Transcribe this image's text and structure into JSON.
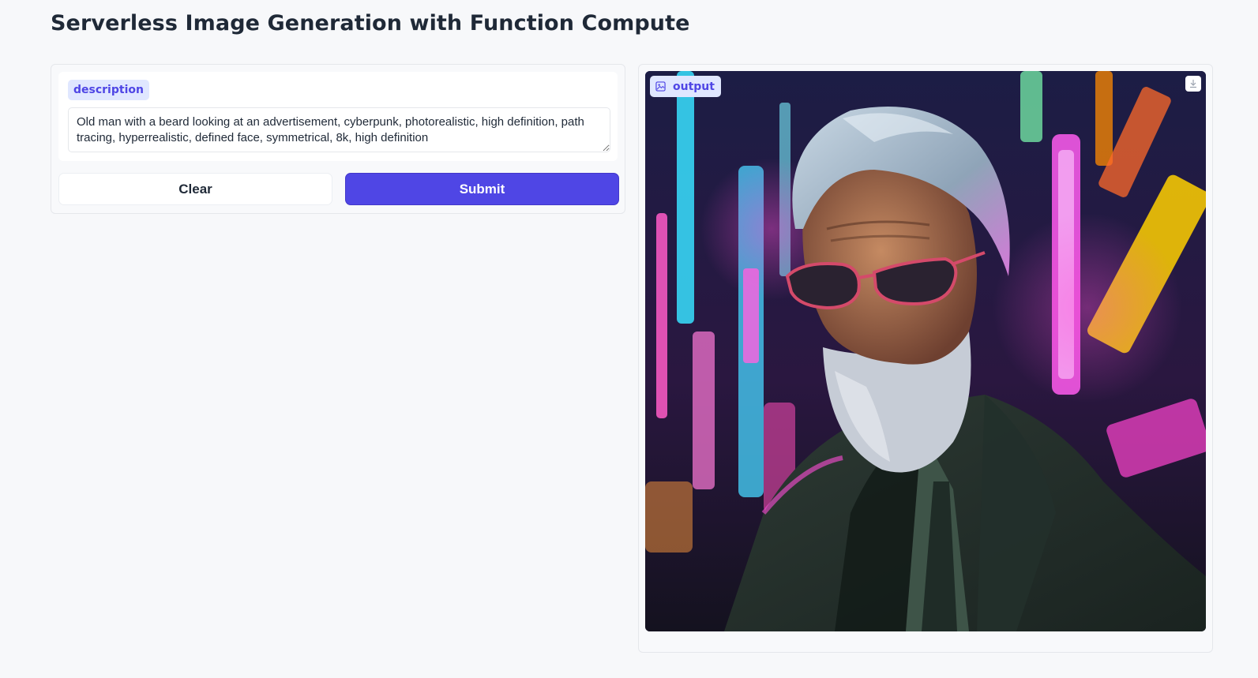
{
  "page": {
    "title": "Serverless Image Generation with Function Compute"
  },
  "input": {
    "label": "description",
    "value": "Old man with a beard looking at an advertisement, cyberpunk, photorealistic, high definition, path tracing, hyperrealistic, defined face, symmetrical, 8k, high definition"
  },
  "buttons": {
    "clear_label": "Clear",
    "submit_label": "Submit"
  },
  "output": {
    "label": "output",
    "icons": {
      "label_icon": "image-icon",
      "download": "download-icon"
    }
  },
  "colors": {
    "accent": "#4f46e5",
    "label_bg": "#e0e7ff",
    "page_bg": "#f7f8fa"
  }
}
